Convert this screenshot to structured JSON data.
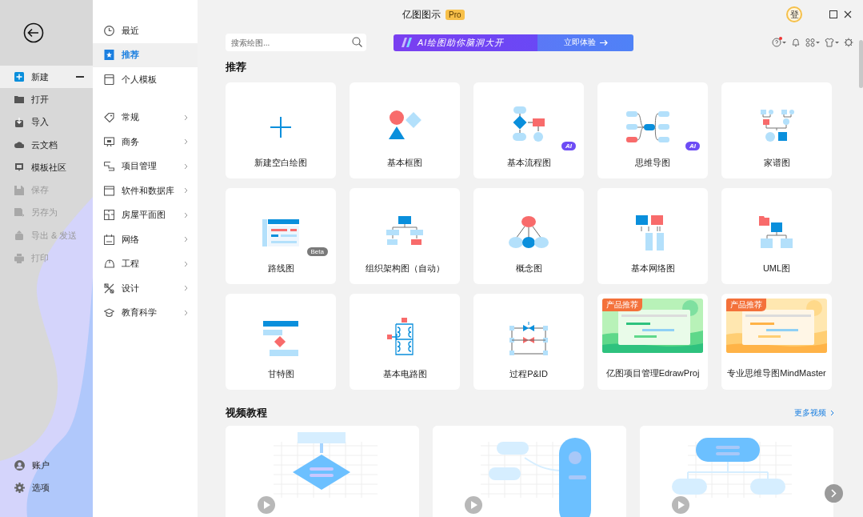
{
  "window": {
    "title": "亿图图示",
    "edition": "Pro",
    "avatar": "登"
  },
  "nav": {
    "items": [
      {
        "label": "新建",
        "selected": true,
        "disabled": false
      },
      {
        "label": "打开",
        "selected": false,
        "disabled": false
      },
      {
        "label": "导入",
        "selected": false,
        "disabled": false
      },
      {
        "label": "云文档",
        "selected": false,
        "disabled": false
      },
      {
        "label": "模板社区",
        "selected": false,
        "disabled": false
      },
      {
        "label": "保存",
        "selected": false,
        "disabled": true
      },
      {
        "label": "另存为",
        "selected": false,
        "disabled": true
      },
      {
        "label": "导出 & 发送",
        "selected": false,
        "disabled": true
      },
      {
        "label": "打印",
        "selected": false,
        "disabled": true
      }
    ],
    "footer": [
      {
        "label": "账户"
      },
      {
        "label": "选项"
      }
    ]
  },
  "categories": {
    "primary": [
      {
        "label": "最近",
        "selected": false
      },
      {
        "label": "推荐",
        "selected": true
      },
      {
        "label": "个人模板",
        "selected": false
      }
    ],
    "items": [
      {
        "label": "常规"
      },
      {
        "label": "商务"
      },
      {
        "label": "项目管理"
      },
      {
        "label": "软件和数据库"
      },
      {
        "label": "房屋平面图"
      },
      {
        "label": "网络"
      },
      {
        "label": "工程"
      },
      {
        "label": "设计"
      },
      {
        "label": "教育科学"
      }
    ]
  },
  "search": {
    "placeholder": "搜索绘图..."
  },
  "banner": {
    "headline": "AI绘图助你脑洞大开",
    "action": "立即体验"
  },
  "recommended": {
    "heading": "推荐",
    "cards": [
      {
        "label": "新建空白绘图",
        "kind": "template"
      },
      {
        "label": "基本框图",
        "kind": "template"
      },
      {
        "label": "基本流程图",
        "kind": "template",
        "badge": {
          "text": "AI",
          "kind": "ai"
        }
      },
      {
        "label": "思维导图",
        "kind": "template",
        "badge": {
          "text": "AI",
          "kind": "ai"
        }
      },
      {
        "label": "家谱图",
        "kind": "template"
      },
      {
        "label": "路线图",
        "kind": "template",
        "badge": {
          "text": "Beta",
          "kind": "beta"
        }
      },
      {
        "label": "组织架构图（自动）",
        "kind": "template"
      },
      {
        "label": "概念图",
        "kind": "template"
      },
      {
        "label": "基本网络图",
        "kind": "template"
      },
      {
        "label": "UML图",
        "kind": "template"
      },
      {
        "label": "甘特图",
        "kind": "template"
      },
      {
        "label": "基本电路图",
        "kind": "template"
      },
      {
        "label": "过程P&ID",
        "kind": "template"
      },
      {
        "label": "亿图项目管理EdrawProj",
        "kind": "product",
        "badge": {
          "text": "产品推荐",
          "kind": "promo"
        }
      },
      {
        "label": "专业思维导图MindMaster",
        "kind": "product",
        "badge": {
          "text": "产品推荐",
          "kind": "promo"
        }
      }
    ]
  },
  "videos": {
    "heading": "视频教程",
    "more": "更多视频"
  }
}
